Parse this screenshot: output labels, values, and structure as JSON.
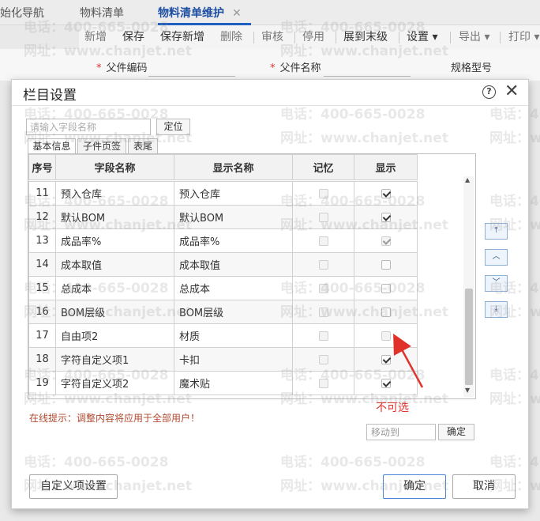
{
  "tabs": [
    {
      "label": "始化导航"
    },
    {
      "label": "物料清单"
    },
    {
      "label": "物料清单维护",
      "close": "✕"
    }
  ],
  "toolbar": {
    "new": "新增",
    "save": "保存",
    "save_new": "保存新增",
    "delete": "删除",
    "audit": "审核",
    "disable": "停用",
    "expand": "展到末级",
    "settings": "设置",
    "export": "导出",
    "print": "打印"
  },
  "form": {
    "parent_code": "父件编码",
    "parent_name": "父件名称",
    "spec": "规格型号"
  },
  "dialog": {
    "title": "栏目设置",
    "help_icon": "?",
    "close_icon": "✕",
    "search_placeholder": "请输入字段名称",
    "locate_label": "定位",
    "subtabs": [
      "基本信息",
      "子件页签",
      "表尾"
    ],
    "columns": [
      "序号",
      "字段名称",
      "显示名称",
      "记忆",
      "显示"
    ],
    "rows": [
      {
        "no": "11",
        "field": "预入仓库",
        "display": "预入仓库",
        "remember": false,
        "show": true
      },
      {
        "no": "12",
        "field": "默认BOM",
        "display": "默认BOM",
        "remember": false,
        "show": true
      },
      {
        "no": "13",
        "field": "成品率%",
        "display": "成品率%",
        "remember": false,
        "show": true
      },
      {
        "no": "14",
        "field": "成本取值",
        "display": "成本取值",
        "remember": false,
        "show": false
      },
      {
        "no": "15",
        "field": "总成本",
        "display": "总成本",
        "remember": false,
        "show": false
      },
      {
        "no": "16",
        "field": "BOM层级",
        "display": "BOM层级",
        "remember": false,
        "show": false
      },
      {
        "no": "17",
        "field": "自由项2",
        "display": "材质",
        "remember": false,
        "show": false
      },
      {
        "no": "18",
        "field": "字符自定义项1",
        "display": "卡扣",
        "remember": false,
        "show": true
      },
      {
        "no": "19",
        "field": "字符自定义项2",
        "display": "魔术贴",
        "remember": false,
        "show": true
      }
    ],
    "hint": "在线提示：调整内容将应用于全部用户！",
    "moveto_placeholder": "移动到",
    "moveto_confirm": "确定",
    "annotation": "不可选",
    "custom_button": "自定义项设置",
    "ok_button": "确定",
    "cancel_button": "取消",
    "side_buttons": [
      "move-top",
      "move-up",
      "move-down",
      "move-bottom"
    ]
  },
  "watermark": {
    "phone": "电话：400-665-0028",
    "site": "网址：www.chanjet.net"
  }
}
